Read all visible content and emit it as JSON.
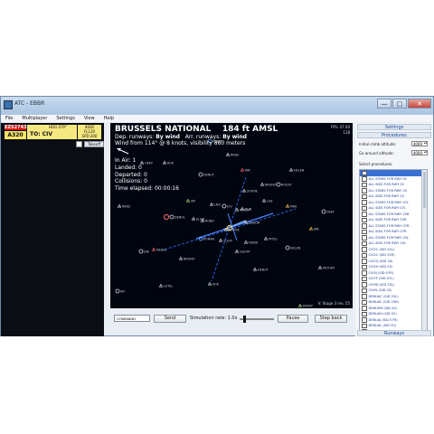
{
  "window": {
    "title": "ATC - EBBR",
    "minimize": "—",
    "maximize": "□",
    "close": "✕"
  },
  "menu": [
    "File",
    "Multiplayer",
    "Settings",
    "View",
    "Help"
  ],
  "strip": {
    "callsign": "EZS2743",
    "aircraft": "A320",
    "heading": "HDG 070°",
    "to": "TO: CIV",
    "alt1": "4000",
    "alt2": "FL120",
    "speed": "SPD 200",
    "takeoff_label": "Takeoff"
  },
  "radar": {
    "airport": "BRUSSELS NATIONAL",
    "elevation": "184 ft AMSL",
    "dep_prefix": "Dep. runways:",
    "dep_value": "By wind",
    "arr_prefix": "Arr. runways:",
    "arr_value": "By wind",
    "wind": "Wind from 114° @ 8 knots, visibility 860 meters",
    "stats": [
      "In Air: 1",
      "Landed: 0",
      "Departed: 0",
      "Collisions: 0",
      "Time elapsed: 00:00:16"
    ],
    "fps": "FPS: 47.00",
    "fps2": "118",
    "stage": "V: Stage 3 rev. 55",
    "labels": [
      "KERKY",
      "KOK",
      "OEKY",
      "RINIS",
      "DENUT",
      "NIK",
      "HELEN",
      "BRUNO",
      "ROUSY",
      "SOPOK",
      "SPI",
      "LNO",
      "CIV",
      "BUN",
      "LGE",
      "MAK",
      "DENOL",
      "ELSIK",
      "ROBO",
      "BEDUM",
      "KONAN",
      "TULPI",
      "FERDI",
      "PITES",
      "DIK",
      "NEBUL",
      "GILOM",
      "WOODY",
      "AFI",
      "LUTEL"
    ]
  },
  "command": {
    "placeholder": "COMMAND",
    "send": "Send",
    "simrate": "Simulation rate: 1.0x",
    "pause": "Pause",
    "step": "Step back",
    "slider_value": 0.12
  },
  "settings": {
    "header": "Settings",
    "procedures_header": "Procedures",
    "initial_label": "Initial climb altitude:",
    "initial_value": "4000",
    "goaround_label": "Go around altitude:",
    "goaround_value": "4000",
    "select_label": "Select procedures:",
    "runways_header": "Runways",
    "procedures": [
      {
        "label": "",
        "selected": true
      },
      {
        "label": "ALL STARS FOR RWY 02",
        "selected": false
      },
      {
        "label": "ALL SIDS FOR RWY 02",
        "selected": false
      },
      {
        "label": "ALL STARS FOR RWY 20",
        "selected": false
      },
      {
        "label": "ALL SIDS FOR RWY 20",
        "selected": false
      },
      {
        "label": "ALL STARS FOR RWY 07L",
        "selected": false
      },
      {
        "label": "ALL SIDS FOR RWY 07L",
        "selected": false
      },
      {
        "label": "ALL STARS FOR RWY 25R",
        "selected": false
      },
      {
        "label": "ALL SIDS FOR RWY 25R",
        "selected": false
      },
      {
        "label": "ALL STARS FOR RWY 07R",
        "selected": false
      },
      {
        "label": "ALL SIDS FOR RWY 07R",
        "selected": false
      },
      {
        "label": "ALL STARS FOR RWY 25L",
        "selected": false
      },
      {
        "label": "ALL SIDS FOR RWY 25L",
        "selected": false
      },
      {
        "label": "CIV2C (SID 25L)",
        "selected": false
      },
      {
        "label": "CIV2C (SID 25R)",
        "selected": false
      },
      {
        "label": "CIV2Q (SID 20)",
        "selected": false
      },
      {
        "label": "CIV5H (SID 02)",
        "selected": false
      },
      {
        "label": "CIV5J (SID 07R)",
        "selected": false
      },
      {
        "label": "CIV7F (SID 07L)",
        "selected": false
      },
      {
        "label": "CIV9D (SID 25L)",
        "selected": false
      },
      {
        "label": "CIV9L (SID 20)",
        "selected": false
      },
      {
        "label": "DENUAC (SID 25L)",
        "selected": false
      },
      {
        "label": "DENUAC (SID 25R)",
        "selected": false
      },
      {
        "label": "DENUEM (SID 20)",
        "selected": false
      },
      {
        "label": "DENUAH (SID 02)",
        "selected": false
      },
      {
        "label": "DENUAJ (SID 07R)",
        "selected": false
      },
      {
        "label": "DENUAL (SID 20)",
        "selected": false
      },
      {
        "label": "DENUAP (SID 02)",
        "selected": false
      },
      {
        "label": "ELSIYF (SID 07L)",
        "selected": false
      }
    ]
  }
}
